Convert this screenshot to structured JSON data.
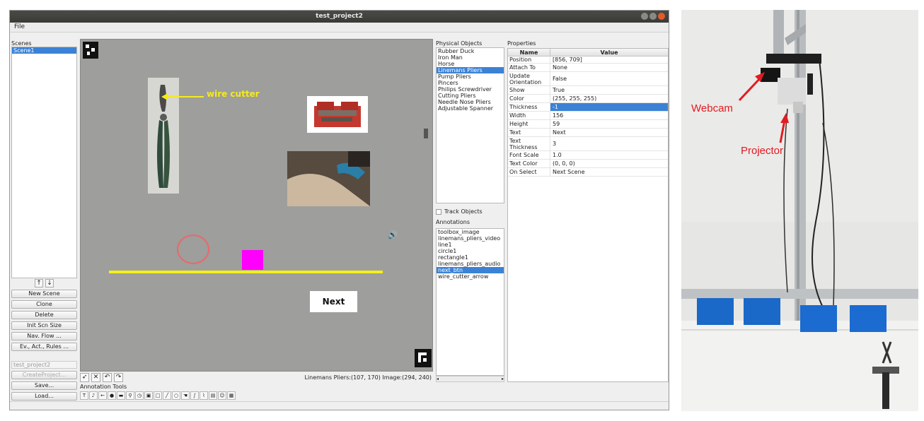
{
  "window": {
    "title": "test_project2"
  },
  "menu": {
    "file": "File"
  },
  "scenes": {
    "label": "Scenes",
    "items": [
      "Scene1"
    ],
    "buttons": {
      "new_scene": "New Scene",
      "clone": "Clone",
      "delete": "Delete",
      "init_scn_size": "Init Scn Size",
      "nav_flow": "Nav. Flow ...",
      "ev_act_rules": "Ev., Act., Rules ..."
    },
    "project_name": "test_project2",
    "create_project": "CreateProject...",
    "save": "Save...",
    "load": "Load..."
  },
  "canvas": {
    "wire_cutter_text": "wire cutter",
    "next_button_text": "Next",
    "status": "Linemans Pliers:(107, 170)  Image:(294, 240)"
  },
  "annotation_tools": {
    "label": "Annotation Tools"
  },
  "physical_objects": {
    "label": "Physical Objects",
    "items": [
      "Rubber Duck",
      "Iron Man",
      "Horse",
      "Linemans Pliers",
      "Pump Pliers",
      "Pincers",
      "Philips Screwdriver",
      "Cutting Pliers",
      "Needle Nose Pliers",
      "Adjustable Spanner"
    ],
    "selected_index": 3
  },
  "track_objects": "Track Objects",
  "annotations": {
    "label": "Annotations",
    "items": [
      "toolbox_image",
      "linemans_pliers_video",
      "line1",
      "circle1",
      "rectangle1",
      "linemans_pliers_audio",
      "next_btn",
      "wire_cutter_arrow"
    ],
    "selected_index": 6
  },
  "properties": {
    "label": "Properties",
    "col_name": "Name",
    "col_value": "Value",
    "rows": [
      {
        "name": "Position",
        "value": "[856, 709]"
      },
      {
        "name": "Attach To",
        "value": "None"
      },
      {
        "name": "Update Orientation",
        "value": "False"
      },
      {
        "name": "Show",
        "value": "True"
      },
      {
        "name": "Color",
        "value": "(255, 255, 255)"
      },
      {
        "name": "Thickness",
        "value": "-1"
      },
      {
        "name": "Width",
        "value": "156"
      },
      {
        "name": "Height",
        "value": "59"
      },
      {
        "name": "Text",
        "value": "Next"
      },
      {
        "name": "Text Thickness",
        "value": "3"
      },
      {
        "name": "Font Scale",
        "value": "1.0"
      },
      {
        "name": "Text Color",
        "value": "(0, 0, 0)"
      },
      {
        "name": "On Select",
        "value": "Next Scene"
      }
    ],
    "selected_index": 5
  },
  "photo": {
    "webcam_label": "Webcam",
    "projector_label": "Projector"
  },
  "colors": {
    "selection": "#3b82d6",
    "canvas_bg": "#9e9e9c",
    "annotation_yellow": "#f4ef1a",
    "magenta": "#ff00ff",
    "label_red": "#e11b22"
  }
}
